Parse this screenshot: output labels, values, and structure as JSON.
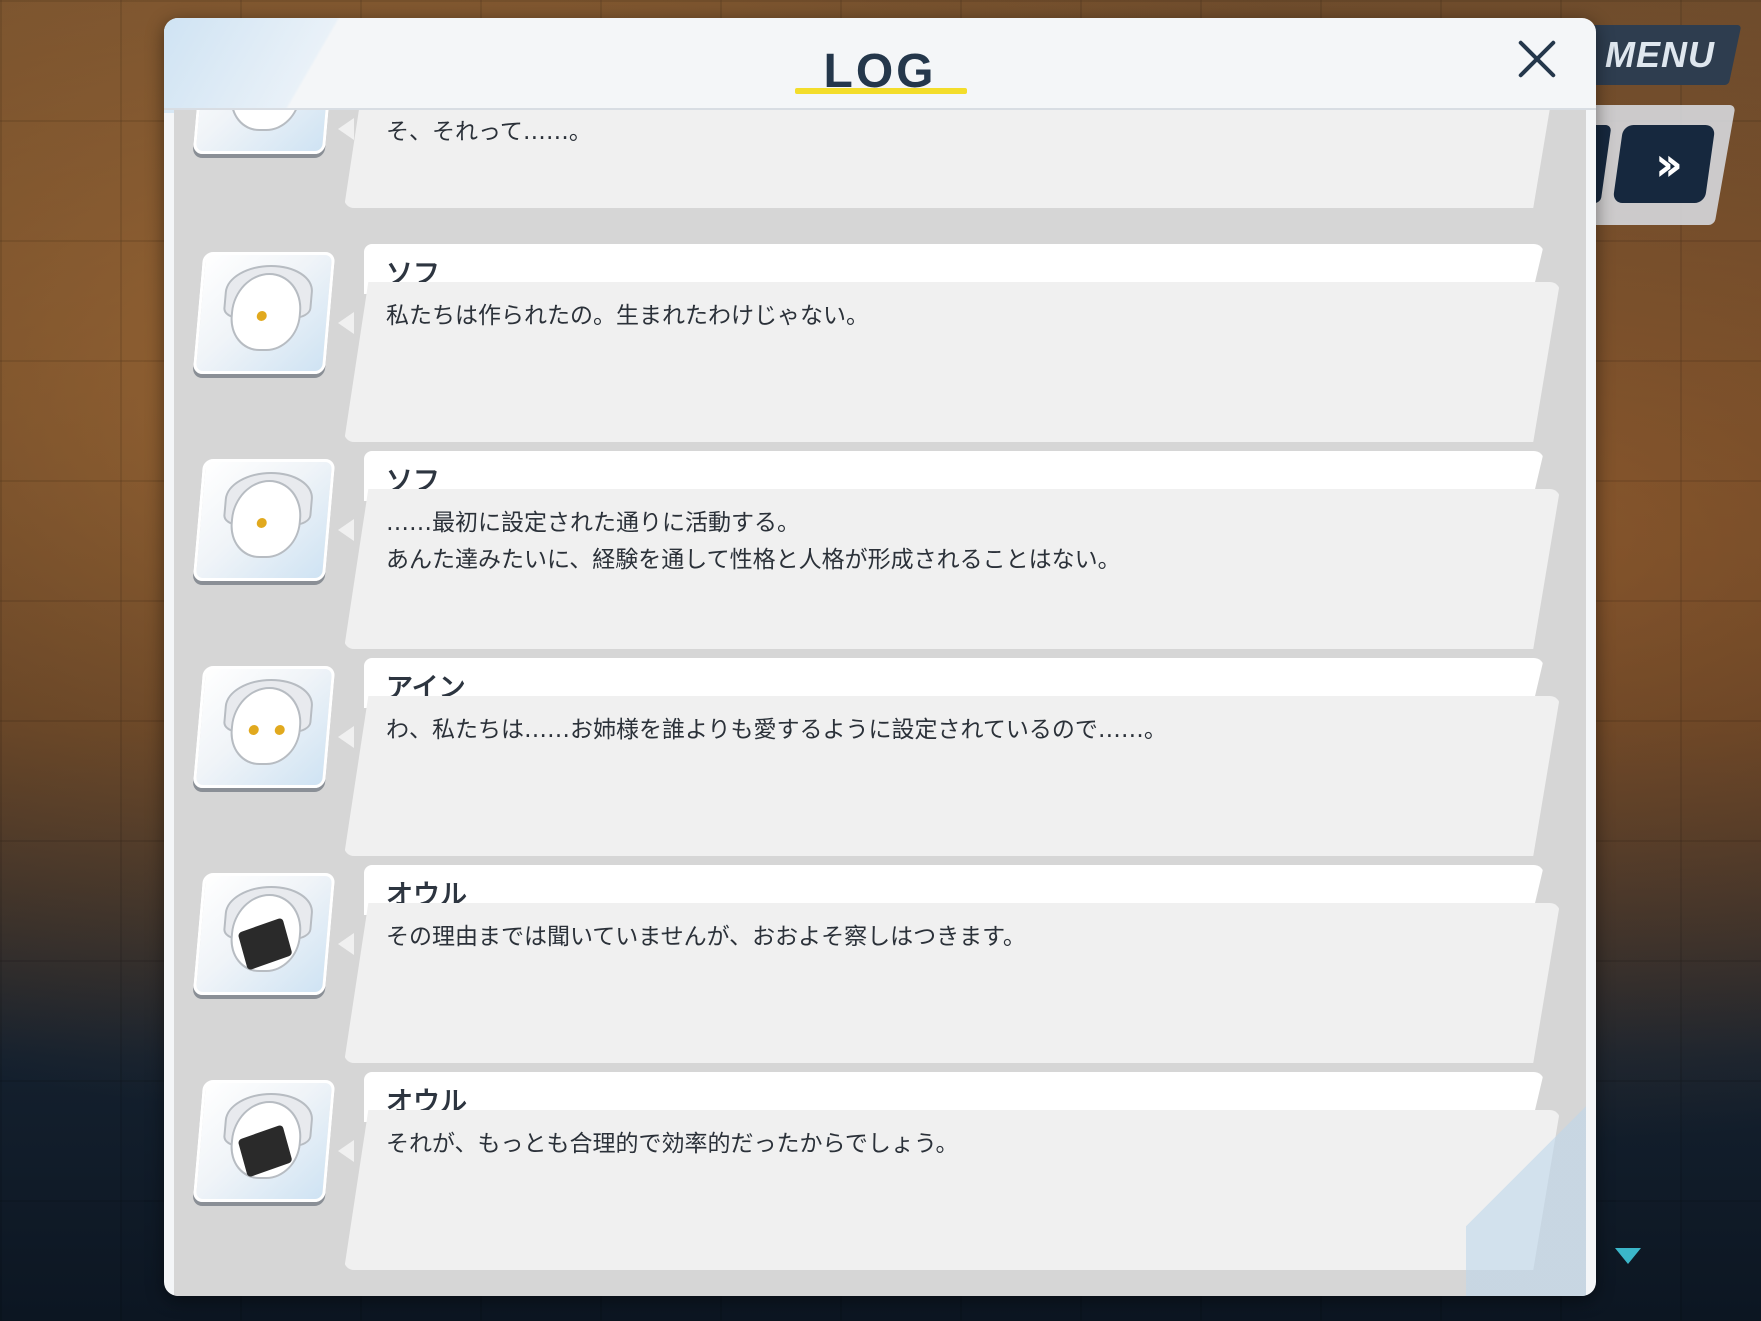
{
  "header": {
    "title": "LOG"
  },
  "top_right": {
    "menu_label": "MENU",
    "fast_forward_icon": "double-chevron-right-icon"
  },
  "close_icon": "close-icon",
  "entries": [
    {
      "speaker": "",
      "text": "そ、それって……。",
      "avatar": "dark-haired-girl"
    },
    {
      "speaker": "ソフ",
      "text": "私たちは作られたの。生まれたわけじゃない。",
      "avatar": "sofu"
    },
    {
      "speaker": "ソフ",
      "text": "……最初に設定された通りに活動する。\nあんた達みたいに、経験を通して性格と人格が形成されることはない。",
      "avatar": "sofu"
    },
    {
      "speaker": "アイン",
      "text": "わ、私たちは……お姉様を誰よりも愛するように設定されているので……。",
      "avatar": "ain"
    },
    {
      "speaker": "オウル",
      "text": "その理由までは聞いていませんが、おおよそ察しはつきます。",
      "avatar": "owl"
    },
    {
      "speaker": "オウル",
      "text": "それが、もっとも合理的で効率的だったからでしょう。",
      "avatar": "owl"
    }
  ]
}
